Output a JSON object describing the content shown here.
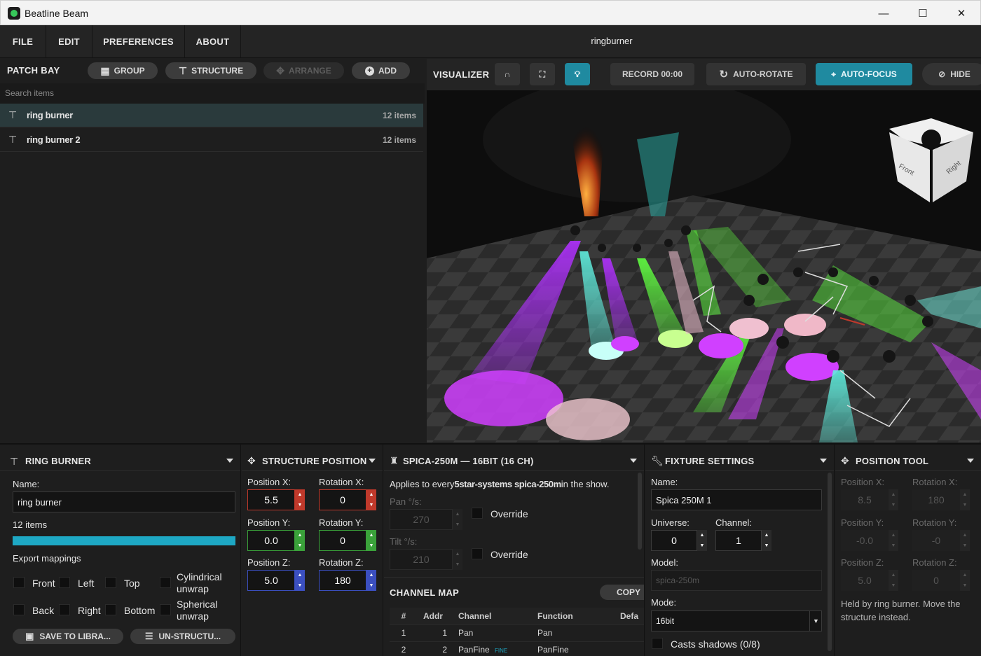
{
  "window": {
    "title": "Beatline Beam",
    "min": "—",
    "max": "☐",
    "close": "✕"
  },
  "menu": {
    "file": "FILE",
    "edit": "EDIT",
    "preferences": "PREFERENCES",
    "about": "ABOUT",
    "show_name": "ringburner"
  },
  "patchbay": {
    "title": "PATCH BAY",
    "group": "GROUP",
    "structure": "STRUCTURE",
    "arrange": "ARRANGE",
    "add": "ADD",
    "search_placeholder": "Search items",
    "items": [
      {
        "name": "ring burner",
        "count": "12 items"
      },
      {
        "name": "ring burner 2",
        "count": "12 items"
      }
    ]
  },
  "visualizer": {
    "title": "VISUALIZER",
    "record": "RECORD 00:00",
    "auto_rotate": "AUTO-ROTATE",
    "auto_focus": "AUTO-FOCUS",
    "hide": "HIDE",
    "cube": {
      "front": "Front",
      "right": "Right"
    }
  },
  "ring": {
    "title": "RING BURNER",
    "name_label": "Name:",
    "name_value": "ring burner",
    "items_count": "12 items",
    "progress": 1.0,
    "export_label": "Export mappings",
    "mappings": [
      "Front",
      "Left",
      "Top",
      "Cylindrical unwrap",
      "Back",
      "Right",
      "Bottom",
      "Spherical unwrap"
    ],
    "save": "SAVE TO LIBRA...",
    "unstructure": "UN-STRUCTU..."
  },
  "structure_position": {
    "title": "STRUCTURE POSITION",
    "pos_x_label": "Position X:",
    "pos_x": "5.5",
    "rot_x_label": "Rotation X:",
    "rot_x": "0",
    "pos_y_label": "Position Y:",
    "pos_y": "0.0",
    "rot_y_label": "Rotation Y:",
    "rot_y": "0",
    "pos_z_label": "Position Z:",
    "pos_z": "5.0",
    "rot_z_label": "Rotation Z:",
    "rot_z": "180"
  },
  "spica": {
    "title": "SPICA-250M — 16BIT (16 CH)",
    "applies_pre": "Applies to every",
    "applies_bold": "5star-systems spica-250m",
    "applies_post": "in the show.",
    "pan_label": "Pan °/s:",
    "pan": "270",
    "tilt_label": "Tilt °/s:",
    "tilt": "210",
    "override": "Override",
    "channel_map_title": "CHANNEL MAP",
    "copy": "COPY",
    "columns": [
      "#",
      "Addr",
      "Channel",
      "Function",
      "Defa"
    ],
    "rows": [
      {
        "n": "1",
        "addr": "1",
        "channel": "Pan",
        "tag": "",
        "function": "Pan"
      },
      {
        "n": "2",
        "addr": "2",
        "channel": "PanFine",
        "tag": "FINE",
        "function": "PanFine"
      }
    ]
  },
  "fixture": {
    "title": "FIXTURE SETTINGS",
    "name_label": "Name:",
    "name_value": "Spica 250M 1",
    "universe_label": "Universe:",
    "universe": "0",
    "channel_label": "Channel:",
    "channel": "1",
    "model_label": "Model:",
    "model_placeholder": "spica-250m",
    "mode_label": "Mode:",
    "mode": "16bit",
    "shadows": "Casts shadows (0/8)"
  },
  "position_tool": {
    "title": "POSITION TOOL",
    "pos_x_label": "Position X:",
    "pos_x": "8.5",
    "rot_x_label": "Rotation X:",
    "rot_x": "180",
    "pos_y_label": "Position Y:",
    "pos_y": "-0.0",
    "rot_y_label": "Rotation Y:",
    "rot_y": "-0",
    "pos_z_label": "Position Z:",
    "pos_z": "5.0",
    "rot_z_label": "Rotation Z:",
    "rot_z": "0",
    "note": "Held by ring burner. Move the structure instead."
  },
  "colors": {
    "accent": "#1f8aa0",
    "x_axis": "#c0392b",
    "y_axis": "#3aa13a",
    "z_axis": "#3b4fbf"
  }
}
